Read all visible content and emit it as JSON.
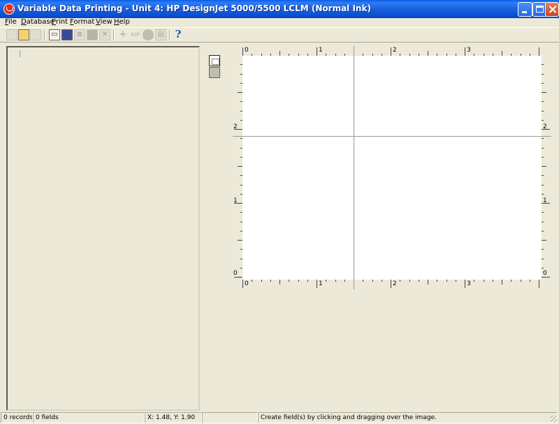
{
  "window": {
    "title": "Variable Data Printing  -  Unit 4: HP  DesignJet 5000/5500 LCLM (Normal Ink)",
    "colors": {
      "titlebar": "#0b55d6",
      "background": "#ece9d8",
      "close": "#c8451c"
    }
  },
  "menu": [
    {
      "key": "F",
      "rest": "ile"
    },
    {
      "key": "D",
      "rest": "atabase"
    },
    {
      "key": "P",
      "rest": "rint"
    },
    {
      "key": "F",
      "rest": "ormat",
      "prefix": ""
    },
    {
      "key": "V",
      "rest": "iew"
    },
    {
      "key": "H",
      "rest": "elp"
    }
  ],
  "toolbar": {
    "icons": [
      "new-document-icon",
      "open-folder-icon",
      "save-icon",
      "add-image-icon",
      "edit-record-icon",
      "records-icon",
      "copy-record-icon",
      "delete-record-icon",
      "add-field-icon",
      "rip-icon",
      "print-icon",
      "print-preview-icon",
      "help-icon"
    ],
    "rip_label": "RIP",
    "help_glyph": "?"
  },
  "rulers": {
    "horizontal_labels": [
      "0",
      "1",
      "2",
      "3"
    ],
    "vertical_labels": [
      "2",
      "1",
      "0"
    ]
  },
  "statusbar": {
    "records": "0 records",
    "fields": "0 fields",
    "coords": "X: 1.48, Y: 1.90",
    "hint": "Create field(s) by clicking and dragging over the image."
  }
}
